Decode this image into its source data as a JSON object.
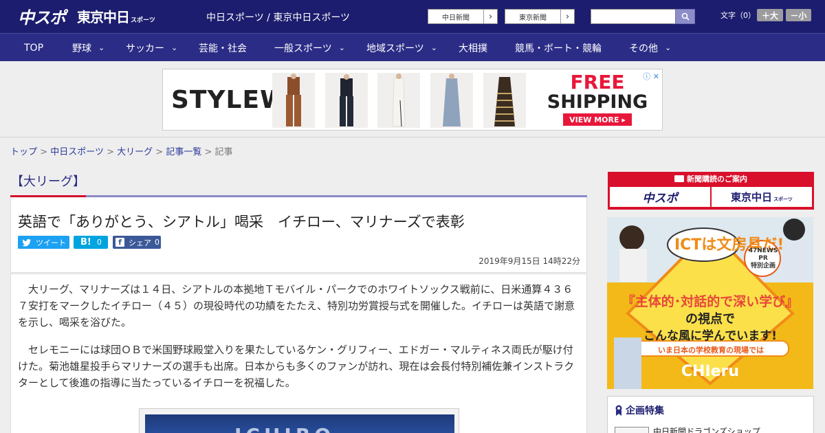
{
  "header": {
    "logo_primary": "中スポ",
    "logo_secondary": "東京中日",
    "logo_secondary_sub": "スポーツ",
    "tagline": "中日スポーツ / 東京中日スポーツ",
    "ext_links": [
      {
        "label": "中日新聞",
        "arrow": "›"
      },
      {
        "label": "東京新聞",
        "arrow": "›"
      }
    ],
    "search": {
      "value": "",
      "placeholder": ""
    },
    "font_size_label": "文字（0）",
    "font_larger": "＋大",
    "font_smaller": "－小"
  },
  "nav": {
    "items": [
      {
        "label": "TOP",
        "has_menu": false
      },
      {
        "label": "野球",
        "has_menu": true
      },
      {
        "label": "サッカー",
        "has_menu": true
      },
      {
        "label": "芸能・社会",
        "has_menu": false
      },
      {
        "label": "一般スポーツ",
        "has_menu": true
      },
      {
        "label": "地域スポーツ",
        "has_menu": true
      },
      {
        "label": "大相撲",
        "has_menu": false
      },
      {
        "label": "競馬・ボート・競輪",
        "has_menu": false
      },
      {
        "label": "その他",
        "has_menu": true
      }
    ],
    "chevron": "⌄"
  },
  "ad_banner": {
    "brand": "STYLEWE",
    "headline_1": "FREE",
    "headline_2": "SHIPPING",
    "cta": "VIEW MORE ▸",
    "adchoices": "ⓘ ✕"
  },
  "breadcrumb": {
    "items": [
      "トップ",
      "中日スポーツ",
      "大リーグ",
      "記事一覧"
    ],
    "separator": ">",
    "current": "記事"
  },
  "article": {
    "category": "【大リーグ】",
    "headline": "英語で「ありがとう、シアトル」喝采　イチロー、マリナーズで表彰",
    "share": {
      "tweet": "ツイート",
      "hatena_count": "0",
      "facebook": "シェア",
      "facebook_count": "0"
    },
    "date": "2019年9月15日 14時22分",
    "paragraphs": [
      "大リーグ、マリナーズは１４日、シアトルの本拠地Ｔモバイル・パークでのホワイトソックス戦前に、日米通算４３６７安打をマークしたイチロー（４５）の現役時代の功績をたたえ、特別功労賞授与式を開催した。イチローは英語で謝意を示し、喝采を浴びた。",
      "セレモニーには球団ＯＢで米国野球殿堂入りを果たしているケン・グリフィー、エドガー・マルティネス両氏が駆け付けた。菊池雄星投手らマリナーズの選手も出席。日本からも多くのファンが訪れ、現在は会長付特別補佐兼インストラクターとして後進の指導に当たっているイチローを祝福した。"
    ],
    "photo_text": "ICHIRO"
  },
  "sidebar": {
    "subscribe_title": "新聞購読のご案内",
    "subscribe_left": "中スポ",
    "subscribe_right": "東京中日",
    "subscribe_right_sub": "スポーツ",
    "ict_ad": {
      "badge": "ICTは文房具だ!",
      "corner_1": "47NEWS",
      "corner_2": "PR",
      "corner_3": "特別企画",
      "line_1": "『主体的･対話的で深い学び』",
      "line_2": "の視点で",
      "line_3": "こんな風に学んでいます!",
      "ribbon": "いま日本の学校教育の現場では",
      "logo": "CHIeru"
    },
    "special_title": "企画特集",
    "special_item": "中日新聞ドラゴンズショップ"
  }
}
